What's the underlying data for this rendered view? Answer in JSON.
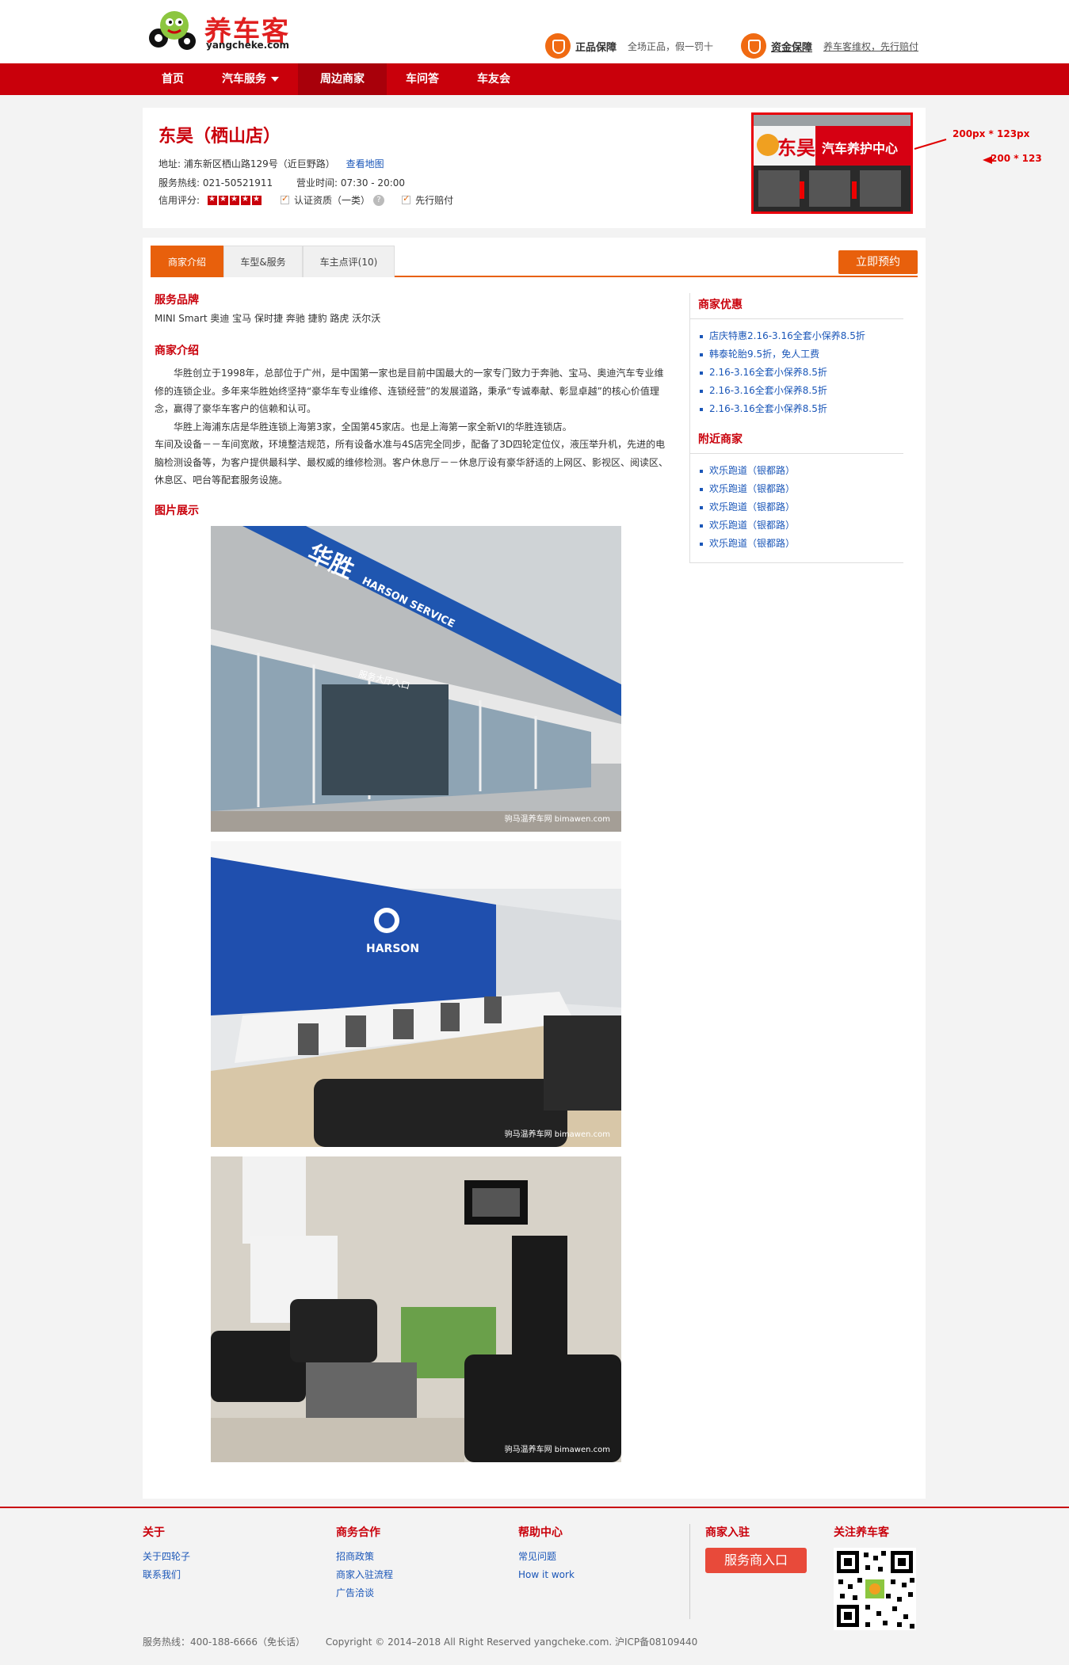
{
  "header": {
    "logo_name": "养车客",
    "logo_url": "yangcheke.com",
    "guarantees": [
      {
        "title": "正品保障",
        "desc": "全场正品，假一罚十"
      },
      {
        "title": "资金保障",
        "desc": "养车客维权，先行赔付"
      }
    ]
  },
  "nav": {
    "items": [
      "首页",
      "汽车服务",
      "周边商家",
      "车问答",
      "车友会"
    ],
    "active": "周边商家"
  },
  "store": {
    "name": "东昊（栖山店）",
    "address_label": "地址:",
    "address": "浦东新区栖山路129号（近巨野路）",
    "map_link": "查看地图",
    "phone_label": "服务热线:",
    "phone": "021-50521911",
    "hours_label": "营业时间:",
    "hours": "07:30 - 20:00",
    "rating_label": "信用评分:",
    "rating_stars": 5,
    "cert": "认证资质（一类）",
    "prepay": "先行赔付",
    "photo_sign_brand": "东昊",
    "photo_sign_text": "汽车养护中心"
  },
  "annotations": {
    "size_note_1": "200px * 123px",
    "size_note_2": "200 * 123"
  },
  "tabs": {
    "items": [
      "商家介绍",
      "车型&服务",
      "车主点评(10)"
    ],
    "active": "商家介绍",
    "book_button": "立即预约"
  },
  "content": {
    "brands_title": "服务品牌",
    "brands": "MINI Smart 奥迪 宝马 保时捷 奔驰 捷豹 路虎 沃尔沃",
    "intro_title": "商家介绍",
    "intro_p1": "华胜创立于1998年，总部位于广州，是中国第一家也是目前中国最大的一家专门致力于奔驰、宝马、奥迪汽车专业维修的连锁企业。多年来华胜始终坚持“豪华车专业维修、连锁经营”的发展道路，秉承“专诚奉献、彰显卓越”的核心价值理念，赢得了豪华车客户的信赖和认可。",
    "intro_p2": "华胜上海浦东店是华胜连锁上海第3家，全国第45家店。也是上海第一家全新VI的华胜连锁店。",
    "intro_p3": "车间及设备－－车间宽敞，环境整洁规范，所有设备水准与4S店完全同步，配备了3D四轮定位仪，液压举升机，先进的电脑检测设备等，为客户提供最科学、最权威的维修检测。客户休息厅－－休息厅设有豪华舒适的上网区、影视区、阅读区、休息区、吧台等配套服务设施。",
    "gallery_title": "图片展示",
    "gallery_watermark": "驹马温养车网 bimawen.com",
    "photo1_sign_cn": "华胜",
    "photo1_sign_en": "HARSON SERVICE",
    "photo1_entrance": "服务大厅入口",
    "photo2_sign": "HARSON"
  },
  "sidebar": {
    "offers_title": "商家优惠",
    "offers": [
      "店庆特惠2.16-3.16全套小保养8.5折",
      "韩泰轮胎9.5折，免人工费",
      "2.16-3.16全套小保养8.5折",
      "2.16-3.16全套小保养8.5折",
      "2.16-3.16全套小保养8.5折"
    ],
    "nearby_title": "附近商家",
    "nearby": [
      "欢乐跑道（银都路）",
      "欢乐跑道（银都路）",
      "欢乐跑道（银都路）",
      "欢乐跑道（银都路）",
      "欢乐跑道（银都路）"
    ]
  },
  "footer": {
    "about_title": "关于",
    "about_links": [
      "关于四轮子",
      "联系我们"
    ],
    "biz_title": "商务合作",
    "biz_links": [
      "招商政策",
      "商家入驻流程",
      "广告洽谈"
    ],
    "help_title": "帮助中心",
    "help_links": [
      "常见问题",
      "How it work"
    ],
    "join_title": "商家入驻",
    "join_button": "服务商入口",
    "follow_title": "关注养车客",
    "hotline": "服务热线：400-188-6666（免长话）",
    "copyright": "Copyright © 2014–2018 All Right Reserved yangcheke.com. 沪ICP备08109440"
  },
  "colors": {
    "brand_red": "#c9000b",
    "accent_orange": "#e8600c",
    "link_blue": "#1a56b8"
  }
}
